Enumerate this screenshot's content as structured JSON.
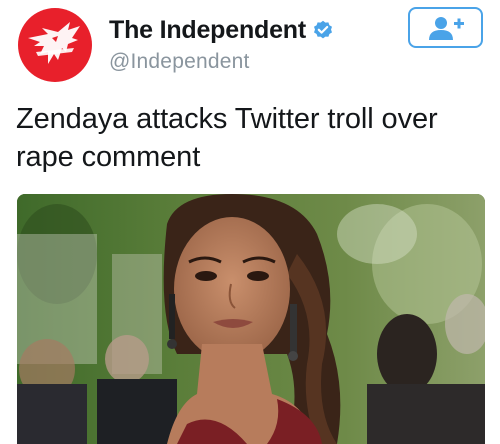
{
  "account": {
    "display_name": "The Independent",
    "handle": "@Independent",
    "verified": true,
    "avatar_icon": "eagle-logo-icon",
    "avatar_color": "#e8202b"
  },
  "follow_button": {
    "icon": "add-user-icon",
    "accent_color": "#4aa3e8"
  },
  "tweet": {
    "text": "Zendaya attacks Twitter troll over rape comment"
  },
  "media": {
    "type": "photo",
    "icon": "photo-icon"
  }
}
